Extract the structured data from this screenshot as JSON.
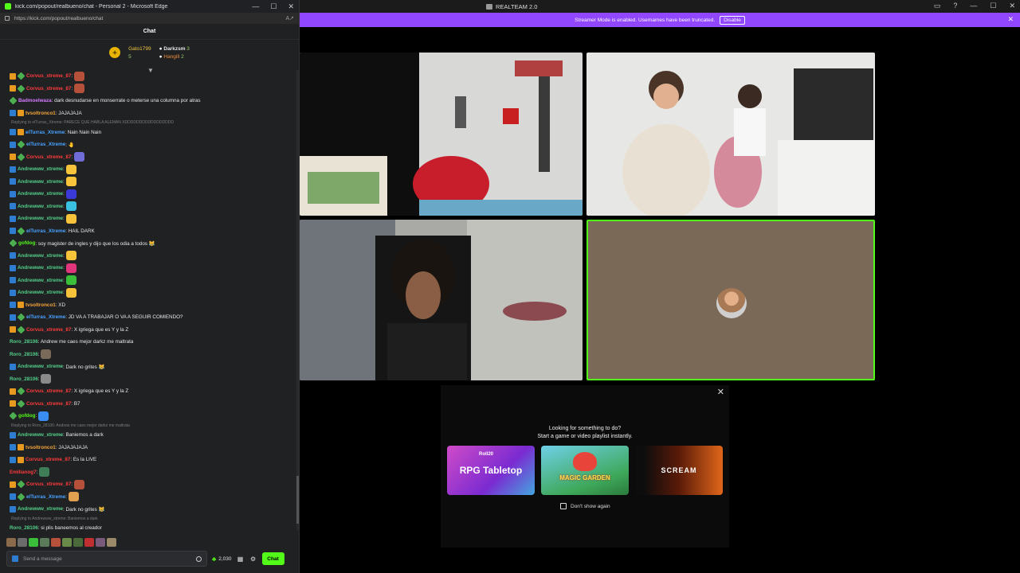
{
  "left_window": {
    "title": "kick.com/popout/realbueno/chat - Personal 2 - Microsoft Edge",
    "url": "https://kick.com/popout/realbueno/chat",
    "chat_title": "Chat",
    "leaderboard": [
      {
        "name": "Gato1799",
        "count": "5"
      },
      {
        "name": "Darkzsm",
        "count": "3"
      },
      {
        "name": "Hangill",
        "count": "2"
      }
    ],
    "messages": [
      {
        "user": "Corvus_xtreme_87",
        "color": "#ff3b3b",
        "badges": [
          "vip",
          "gift"
        ],
        "text": ":",
        "emote": "#b5503a"
      },
      {
        "user": "Corvus_xtreme_87",
        "color": "#ff3b3b",
        "badges": [
          "vip",
          "gift"
        ],
        "text": ":",
        "emote": "#b5503a"
      },
      {
        "user": "Badmoelwaza",
        "color": "#d47bff",
        "badges": [
          "gift"
        ],
        "text": ": dark desnudarse en monserrate o meterse una columna por atras"
      },
      {
        "user": "tvsoltronco1",
        "color": "#f6a53a",
        "badges": [
          "mod",
          "vip"
        ],
        "text": ": JAJAJAJA"
      },
      {
        "reply": "Replying to elTurras_Xtreme: PARECE QUE HABLA ALEMAN XDDDDDDDDDDDDDDDDD"
      },
      {
        "user": "elTurras_Xtreme",
        "color": "#4aa3ff",
        "badges": [
          "mod",
          "vip"
        ],
        "text": ": Nain Nain Nain"
      },
      {
        "user": "elTurras_Xtreme",
        "color": "#4aa3ff",
        "badges": [
          "mod",
          "gift"
        ],
        "text": ": 🤚"
      },
      {
        "user": "Corvus_xtreme_87",
        "color": "#ff3b3b",
        "badges": [
          "vip",
          "gift"
        ],
        "text": ":",
        "emote": "#6f6cd8"
      },
      {
        "user": "Andrewww_xtreme",
        "color": "#53d18a",
        "badges": [
          "mod"
        ],
        "text": ":",
        "emote": "#f6c33a"
      },
      {
        "user": "Andrewww_xtreme",
        "color": "#53d18a",
        "badges": [
          "mod"
        ],
        "text": ":",
        "emote": "#f6c33a"
      },
      {
        "user": "Andrewww_xtreme",
        "color": "#53d18a",
        "badges": [
          "mod"
        ],
        "text": ":",
        "emote": "#3a3ad8"
      },
      {
        "user": "Andrewww_xtreme",
        "color": "#53d18a",
        "badges": [
          "mod"
        ],
        "text": ":",
        "emote": "#3ac0e0"
      },
      {
        "user": "Andrewww_xtreme",
        "color": "#53d18a",
        "badges": [
          "mod"
        ],
        "text": ":",
        "emote": "#f6c33a"
      },
      {
        "user": "elTurras_Xtreme",
        "color": "#4aa3ff",
        "badges": [
          "mod",
          "gift"
        ],
        "text": ": HAIL DARK"
      },
      {
        "user": "gofdog",
        "color": "#53fc18",
        "badges": [
          "gift"
        ],
        "text": ": soy magister de ingles y dijo que los odia a todos 😹"
      },
      {
        "user": "Andrewww_xtreme",
        "color": "#53d18a",
        "badges": [
          "mod"
        ],
        "text": ":",
        "emote": "#f6c33a"
      },
      {
        "user": "Andrewww_xtreme",
        "color": "#53d18a",
        "badges": [
          "mod"
        ],
        "text": ":",
        "emote": "#e0357a"
      },
      {
        "user": "Andrewww_xtreme",
        "color": "#53d18a",
        "badges": [
          "mod"
        ],
        "text": ":",
        "emote": "#3bbf3b"
      },
      {
        "user": "Andrewww_xtreme",
        "color": "#53d18a",
        "badges": [
          "mod"
        ],
        "text": ":",
        "emote": "#f6c33a"
      },
      {
        "user": "tvsoltronco1",
        "color": "#f6a53a",
        "badges": [
          "mod",
          "vip"
        ],
        "text": ": XD"
      },
      {
        "user": "elTurras_Xtreme",
        "color": "#4aa3ff",
        "badges": [
          "mod",
          "gift"
        ],
        "text": ": JD VA A TRABAJAR O VA A SEGUIR COMIENDO?"
      },
      {
        "user": "Corvus_xtreme_87",
        "color": "#ff3b3b",
        "badges": [
          "vip",
          "gift"
        ],
        "text": ": X igriega que es Y y la Z"
      },
      {
        "user": "Roro_28106",
        "color": "#53d18a",
        "badges": [],
        "text": ": Andrew me caes mejor darkz me maltrata"
      },
      {
        "user": "Roro_28106",
        "color": "#53d18a",
        "badges": [],
        "text": ":",
        "emote": "#7a6a5a"
      },
      {
        "user": "Andrewww_xtreme",
        "color": "#53d18a",
        "badges": [
          "mod"
        ],
        "text": ": Dark no grites 😹"
      },
      {
        "user": "Roro_28106",
        "color": "#53d18a",
        "badges": [],
        "text": ":",
        "emote": "#8a8a8a"
      },
      {
        "user": "Corvus_xtreme_87",
        "color": "#ff3b3b",
        "badges": [
          "vip",
          "gift"
        ],
        "text": ": X igriega que es Y y la Z"
      },
      {
        "user": "Corvus_xtreme_87",
        "color": "#ff3b3b",
        "badges": [
          "vip",
          "gift"
        ],
        "text": ": B7"
      },
      {
        "user": "gofdog",
        "color": "#53fc18",
        "badges": [
          "gift"
        ],
        "text": ":",
        "emote": "#3a8cf0"
      },
      {
        "reply": "Replying to Roro_28106: Andrew me caes mejor darkz me maltrata"
      },
      {
        "user": "Andrewww_xtreme",
        "color": "#53d18a",
        "badges": [
          "mod"
        ],
        "text": ": Baniemos a dark"
      },
      {
        "user": "tvsoltronco1",
        "color": "#f6a53a",
        "badges": [
          "mod",
          "vip"
        ],
        "text": ": JAJAJAJAJA"
      },
      {
        "user": "Corvus_xtreme_87",
        "color": "#ff3b3b",
        "badges": [
          "mod",
          "vip"
        ],
        "text": ": Es la LIVE"
      },
      {
        "user": "Emilianog7",
        "color": "#ff3b3b",
        "badges": [],
        "text": ":",
        "emote": "#3f7d58"
      },
      {
        "user": "Corvus_xtreme_87",
        "color": "#ff3b3b",
        "badges": [
          "vip",
          "gift"
        ],
        "text": ":",
        "emote": "#b5503a"
      },
      {
        "user": "elTurras_Xtreme",
        "color": "#4aa3ff",
        "badges": [
          "mod",
          "gift"
        ],
        "text": ":",
        "emote": "#e0a050"
      },
      {
        "user": "Andrewww_xtreme",
        "color": "#53d18a",
        "badges": [
          "mod"
        ],
        "text": ": Dark no grites 😹"
      },
      {
        "reply": "Replying to Andrewww_xtreme: Baniemos a dark"
      },
      {
        "user": "Roro_28106",
        "color": "#53d18a",
        "badges": [],
        "text": ": si plis baneemos al creador"
      }
    ],
    "input_placeholder": "Send a message",
    "points": "2,030",
    "chat_button": "Chat"
  },
  "right_window": {
    "title": "REALTEAM 2.0",
    "banner_text": "Streamer Mode is enabled. Usernames have been truncated.",
    "banner_button": "Disable",
    "suggest_title_1": "Looking for something to do?",
    "suggest_title_2": "Start a game or video playlist instantly.",
    "cards": [
      {
        "label": "RPG Tabletop",
        "sub": "Roll20"
      },
      {
        "label": "MAGIC GARDEN"
      },
      {
        "label": "SCREAM"
      }
    ],
    "dont_show": "Don't show again"
  },
  "colors": {
    "kick_green": "#53fc18",
    "banner_purple": "#9146ff"
  }
}
